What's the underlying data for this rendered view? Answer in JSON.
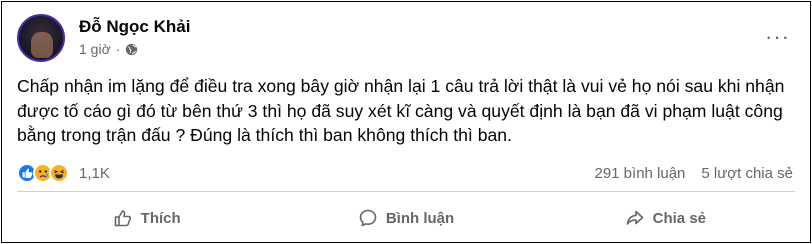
{
  "post": {
    "author": "Đỗ Ngọc Khải",
    "time": "1 giờ",
    "audience_icon": "globe-icon",
    "text": "Chấp nhận im lặng để điều tra xong bây giờ nhận lại 1 câu trả lời thật là vui vẻ họ nói sau khi nhận được tố cáo gì đó từ bên thứ 3 thì họ đã suy xét kĩ càng và quyết định là bạn đã vi phạm luật công bằng trong trận đấu ? Đúng là thích thì ban không thích thì ban."
  },
  "reactions": {
    "icons": [
      "like-icon",
      "sad-icon",
      "haha-icon"
    ],
    "count": "1,1K",
    "comments": "291 bình luận",
    "shares": "5 lượt chia sẻ"
  },
  "actions": {
    "like": "Thích",
    "comment": "Bình luận",
    "share": "Chia sẻ"
  },
  "colors": {
    "like_blue": "#1877f2",
    "emoji_yellow": "#f7b125",
    "secondary_text": "#65676b"
  }
}
